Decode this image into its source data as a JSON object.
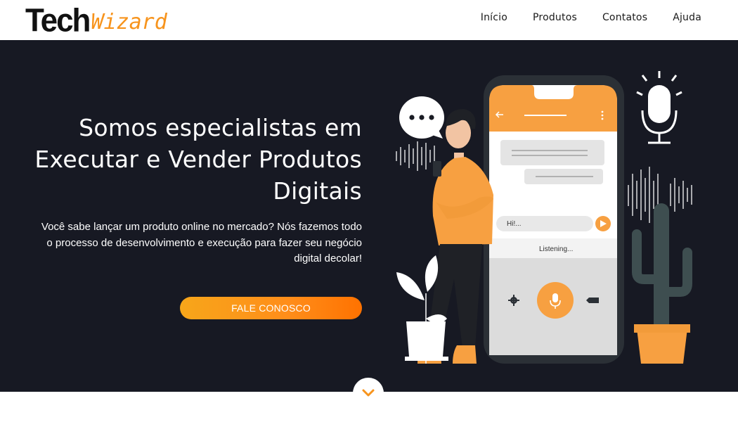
{
  "brand": {
    "part1": "Tech",
    "part2": "Wizard"
  },
  "nav": [
    {
      "label": "Início"
    },
    {
      "label": "Produtos"
    },
    {
      "label": "Contatos"
    },
    {
      "label": "Ajuda"
    }
  ],
  "hero": {
    "title_line1": "Somos especialistas em",
    "title_line2": "Executar e Vender Produtos",
    "title_line3": "Digitais",
    "description": "Você sabe lançar um produto online no mercado? Nós fazemos todo o processo de desenvolvimento e execução para fazer seu negócio digital decolar!",
    "cta_label": "FALE CONOSCO"
  },
  "illustration": {
    "chat_input_text": "Hi!...",
    "status_text": "Listening...",
    "bubble_dots": "•••"
  },
  "colors": {
    "accent": "#f7a041",
    "hero_bg": "#171923",
    "cactus": "#3e4e50"
  },
  "icons": {
    "scroll": "chevron-down-icon",
    "mic": "microphone-icon",
    "settings": "gear-icon",
    "backspace": "backspace-icon",
    "send": "send-icon"
  }
}
